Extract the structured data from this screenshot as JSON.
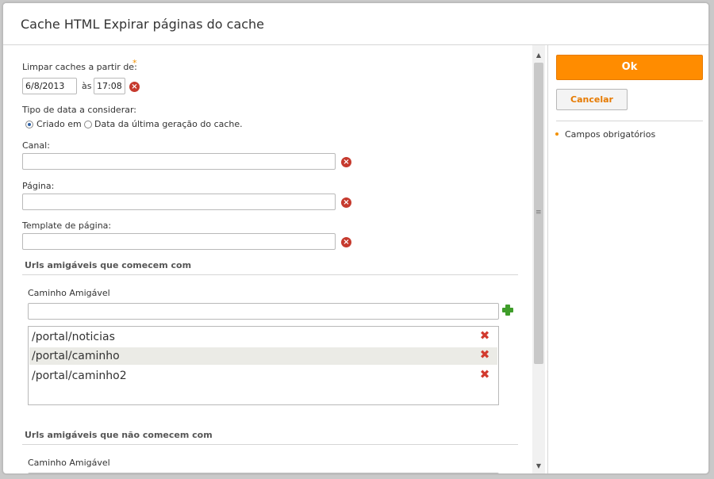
{
  "dialog": {
    "title": "Cache HTML Expirar páginas do cache"
  },
  "form": {
    "clear_from_label": "Limpar caches a partir de:",
    "required_mark": "*",
    "date_value": "6/8/2013",
    "at_label": "às",
    "time_value": "17:08",
    "date_type_label": "Tipo de data a considerar:",
    "radio_created": "Criado em",
    "radio_last_gen": "Data da última geração do cache.",
    "channel_label": "Canal:",
    "channel_value": "",
    "page_label": "Página:",
    "page_value": "",
    "template_label": "Template de página:",
    "template_value": "",
    "section_begin": "Urls amigáveis que comecem com",
    "path_label": "Caminho Amigável",
    "path_value": "",
    "urls": [
      "/portal/noticias",
      "/portal/caminho",
      "/portal/caminho2"
    ],
    "selected_url_index": 1,
    "section_not_begin": "Urls amigáveis que não comecem com",
    "path_label_2": "Caminho Amigável"
  },
  "side": {
    "ok_label": "Ok",
    "cancel_label": "Cancelar",
    "required_note": "Campos obrigatórios"
  },
  "icons": {
    "clear": "clear-icon",
    "delete": "delete-icon",
    "add": "add-icon"
  },
  "colors": {
    "accent": "#ff8c00",
    "delete": "#d23a2e",
    "add": "#3f9d2a"
  }
}
